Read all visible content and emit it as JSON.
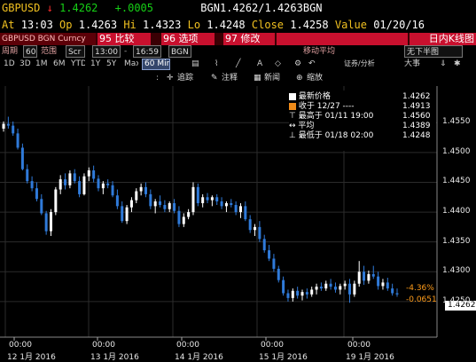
{
  "header": {
    "ticker": "GBPUSD",
    "arrow": "↓",
    "last": "1.4262",
    "change": "+.0005",
    "source": "BGN",
    "bid_ask": "1.4262/1.4263",
    "source2": "BGN",
    "at_label": "At",
    "at_time": "13:03",
    "op_label": "Op",
    "op_value": "1.4263",
    "hi_label": "Hi",
    "hi_value": "1.4323",
    "lo_label": "Lo",
    "lo_value": "1.4248",
    "close_label": "Close",
    "close_value": "1.4258",
    "value_label": "Value",
    "value_date": "01/20/16"
  },
  "toolbar1": {
    "security": "GBPUSD BGN Curncy",
    "compare": "95 比较",
    "options": "96 选项",
    "edit": "97 修改",
    "chart_type": "日内K线图"
  },
  "toolbar2": {
    "period_label": "周期",
    "period_value": "60",
    "range_label": "范围",
    "range_value": "Scr",
    "start_time": "13:00",
    "end_time": "16:59",
    "source": "BGN",
    "ma_label": "移动平均",
    "ma_value": "无下半图"
  },
  "toolbar3": {
    "ranges": [
      "1D",
      "3D",
      "1M",
      "6M",
      "YTD",
      "1Y",
      "5Y",
      "Max"
    ],
    "interval": "60 Min ▾",
    "security_label": "证券/分析",
    "big_label": "大事"
  },
  "toolbar4": {
    "tracking": "追踪",
    "annotate": "注释",
    "news": "新闻",
    "zoom": "缩放"
  },
  "legend": {
    "latest_label": "最新价格",
    "latest_value": "1.4262",
    "close_label": "收于 12/27 ----",
    "close_value": "1.4913",
    "high_label": "最高于 01/11 19:00",
    "high_value": "1.4560",
    "avg_label": "平均",
    "avg_value": "1.4389",
    "low_label": "最低于 01/18 02:00",
    "low_value": "1.4248"
  },
  "annotations": {
    "pct": "-4.36%",
    "abs": "-0.0651",
    "last_tag": "1.4262"
  },
  "chart_data": {
    "type": "candlestick",
    "title": "",
    "ylim": [
      1.4232,
      1.4595
    ],
    "yticks": [
      "1.4550",
      "1.4500",
      "1.4450",
      "1.4400",
      "1.4350",
      "1.4300",
      "1.4250"
    ],
    "xticks": [
      "00:00",
      "00:00",
      "00:00",
      "00:00",
      "00:00"
    ],
    "xdates": [
      "12 1月 2016",
      "13 1月 2016",
      "14 1月 2016",
      "15 1月 2016",
      "19 1月 2016"
    ],
    "grid": true,
    "colors": {
      "up": "#ffffff",
      "down": "#2f7ad9",
      "tick": "#e8e8e8",
      "pct": "#ff9c1a",
      "last_tag_bg": "#ffffff"
    },
    "candles": [
      [
        1.454,
        1.4552,
        1.4535,
        1.4548
      ],
      [
        1.4548,
        1.456,
        1.454,
        1.4545
      ],
      [
        1.4545,
        1.4552,
        1.4528,
        1.4532
      ],
      [
        1.4532,
        1.454,
        1.4505,
        1.4508
      ],
      [
        1.4508,
        1.4515,
        1.447,
        1.4472
      ],
      [
        1.4472,
        1.448,
        1.4448,
        1.4452
      ],
      [
        1.4452,
        1.446,
        1.4435,
        1.444
      ],
      [
        1.444,
        1.445,
        1.4418,
        1.4422
      ],
      [
        1.4422,
        1.443,
        1.4395,
        1.4398
      ],
      [
        1.4398,
        1.4402,
        1.4362,
        1.4368
      ],
      [
        1.4368,
        1.4405,
        1.436,
        1.44
      ],
      [
        1.44,
        1.4442,
        1.4395,
        1.4438
      ],
      [
        1.4438,
        1.4462,
        1.443,
        1.4455
      ],
      [
        1.4455,
        1.4465,
        1.4438,
        1.4445
      ],
      [
        1.4445,
        1.447,
        1.444,
        1.4465
      ],
      [
        1.4465,
        1.4472,
        1.4448,
        1.4452
      ],
      [
        1.4452,
        1.446,
        1.4425,
        1.443
      ],
      [
        1.443,
        1.4465,
        1.4428,
        1.446
      ],
      [
        1.446,
        1.4475,
        1.4452,
        1.447
      ],
      [
        1.447,
        1.4478,
        1.445,
        1.4456
      ],
      [
        1.4456,
        1.4462,
        1.4435,
        1.444
      ],
      [
        1.444,
        1.4452,
        1.443,
        1.4448
      ],
      [
        1.4448,
        1.4455,
        1.444,
        1.4445
      ],
      [
        1.4445,
        1.4452,
        1.4425,
        1.4428
      ],
      [
        1.4428,
        1.4438,
        1.4405,
        1.441
      ],
      [
        1.441,
        1.4418,
        1.4382,
        1.4385
      ],
      [
        1.4385,
        1.4412,
        1.438,
        1.4408
      ],
      [
        1.4408,
        1.4425,
        1.44,
        1.442
      ],
      [
        1.442,
        1.444,
        1.4415,
        1.4435
      ],
      [
        1.4435,
        1.4448,
        1.4428,
        1.4442
      ],
      [
        1.4442,
        1.445,
        1.4425,
        1.443
      ],
      [
        1.443,
        1.4438,
        1.4405,
        1.441
      ],
      [
        1.441,
        1.4422,
        1.4398,
        1.4418
      ],
      [
        1.4418,
        1.4428,
        1.4408,
        1.4412
      ],
      [
        1.4412,
        1.442,
        1.44,
        1.4405
      ],
      [
        1.4405,
        1.4418,
        1.44,
        1.4415
      ],
      [
        1.4415,
        1.4422,
        1.4398,
        1.4402
      ],
      [
        1.4402,
        1.441,
        1.4375,
        1.438
      ],
      [
        1.438,
        1.4398,
        1.4375,
        1.4392
      ],
      [
        1.4392,
        1.4405,
        1.4388,
        1.44
      ],
      [
        1.44,
        1.445,
        1.4395,
        1.4442
      ],
      [
        1.4442,
        1.4448,
        1.441,
        1.4415
      ],
      [
        1.4415,
        1.443,
        1.4408,
        1.4425
      ],
      [
        1.4425,
        1.4432,
        1.4415,
        1.442
      ],
      [
        1.442,
        1.4428,
        1.441,
        1.4425
      ],
      [
        1.4425,
        1.443,
        1.4412,
        1.4418
      ],
      [
        1.4418,
        1.4425,
        1.4405,
        1.441
      ],
      [
        1.441,
        1.4418,
        1.44,
        1.4415
      ],
      [
        1.4415,
        1.4422,
        1.4408,
        1.4412
      ],
      [
        1.4412,
        1.4418,
        1.4395,
        1.44
      ],
      [
        1.44,
        1.4415,
        1.439,
        1.441
      ],
      [
        1.441,
        1.4418,
        1.4385,
        1.4388
      ],
      [
        1.4388,
        1.4395,
        1.4365,
        1.437
      ],
      [
        1.437,
        1.438,
        1.436,
        1.4375
      ],
      [
        1.4375,
        1.4385,
        1.435,
        1.4355
      ],
      [
        1.4355,
        1.4362,
        1.4332,
        1.4336
      ],
      [
        1.4336,
        1.4345,
        1.4318,
        1.4322
      ],
      [
        1.4322,
        1.433,
        1.43,
        1.4305
      ],
      [
        1.4305,
        1.431,
        1.4282,
        1.4286
      ],
      [
        1.4286,
        1.4292,
        1.426,
        1.4264
      ],
      [
        1.4264,
        1.427,
        1.425,
        1.4256
      ],
      [
        1.4256,
        1.4272,
        1.425,
        1.4268
      ],
      [
        1.4268,
        1.4275,
        1.4255,
        1.426
      ],
      [
        1.426,
        1.427,
        1.4252,
        1.4266
      ],
      [
        1.4266,
        1.4272,
        1.4255,
        1.4262
      ],
      [
        1.4262,
        1.4275,
        1.4258,
        1.427
      ],
      [
        1.427,
        1.428,
        1.4262,
        1.4275
      ],
      [
        1.4275,
        1.4282,
        1.4268,
        1.4272
      ],
      [
        1.4272,
        1.4285,
        1.4268,
        1.428
      ],
      [
        1.428,
        1.4288,
        1.427,
        1.4275
      ],
      [
        1.4275,
        1.4282,
        1.4265,
        1.427
      ],
      [
        1.427,
        1.428,
        1.4262,
        1.4276
      ],
      [
        1.4276,
        1.4285,
        1.427,
        1.428
      ],
      [
        1.428,
        1.4288,
        1.4248,
        1.4262
      ],
      [
        1.4262,
        1.4285,
        1.4258,
        1.428
      ],
      [
        1.428,
        1.4318,
        1.4275,
        1.43
      ],
      [
        1.43,
        1.431,
        1.4278,
        1.4285
      ],
      [
        1.4285,
        1.4302,
        1.428,
        1.4296
      ],
      [
        1.4296,
        1.431,
        1.4288,
        1.4292
      ],
      [
        1.4292,
        1.43,
        1.427,
        1.4276
      ],
      [
        1.4276,
        1.4288,
        1.427,
        1.4282
      ],
      [
        1.4282,
        1.429,
        1.4268,
        1.4272
      ],
      [
        1.4272,
        1.428,
        1.426,
        1.4264
      ],
      [
        1.4264,
        1.4272,
        1.4258,
        1.4262
      ]
    ]
  }
}
